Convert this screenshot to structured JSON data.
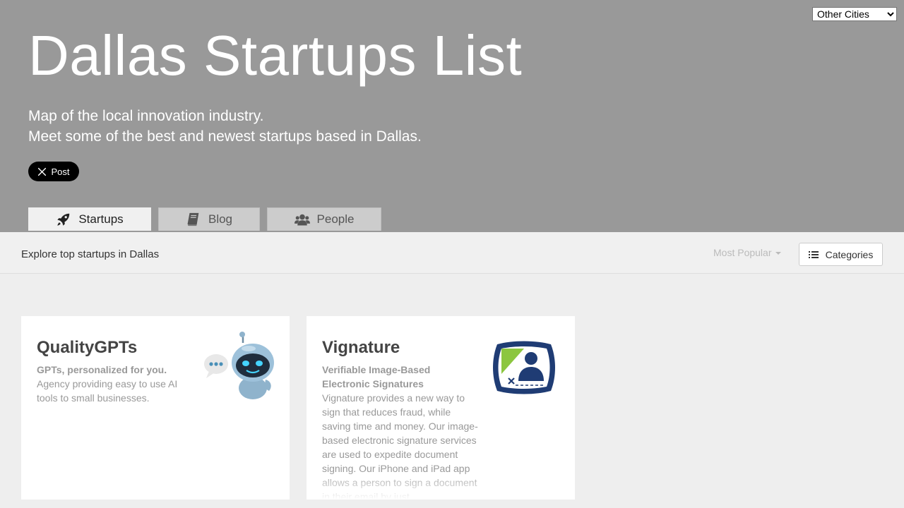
{
  "header": {
    "city_select": {
      "selected": "Other Cities"
    },
    "title": "Dallas Startups List",
    "tagline_line1": "Map of the local innovation industry.",
    "tagline_line2": "Meet some of the best and newest startups based in Dallas.",
    "post_button": "Post"
  },
  "tabs": [
    {
      "label": "Startups",
      "icon": "rocket-icon",
      "active": true
    },
    {
      "label": "Blog",
      "icon": "book-icon",
      "active": false
    },
    {
      "label": "People",
      "icon": "users-icon",
      "active": false
    }
  ],
  "toolbar": {
    "explore_text": "Explore top startups in Dallas",
    "sort_label": "Most Popular",
    "categories_button": "Categories"
  },
  "startups": [
    {
      "name": "QualityGPTs",
      "tagline": "GPTs, personalized for you.",
      "description": "Agency providing easy to use AI tools to small businesses.",
      "logo": "robot-logo"
    },
    {
      "name": "Vignature",
      "tagline": "Verifiable Image-Based Electronic Signatures",
      "description": "Vignature provides a new way to sign that reduces fraud, while saving time and money. Our image-based electronic signature services are used to expedite document signing. Our iPhone and iPad app allows a person to sign a document in their email by just",
      "logo": "signature-logo"
    }
  ],
  "colors": {
    "hero_background": "#999999",
    "page_background": "#eeeeee",
    "card_background": "#ffffff",
    "vignature_navy": "#1f3c74",
    "vignature_green": "#8cc63f"
  }
}
